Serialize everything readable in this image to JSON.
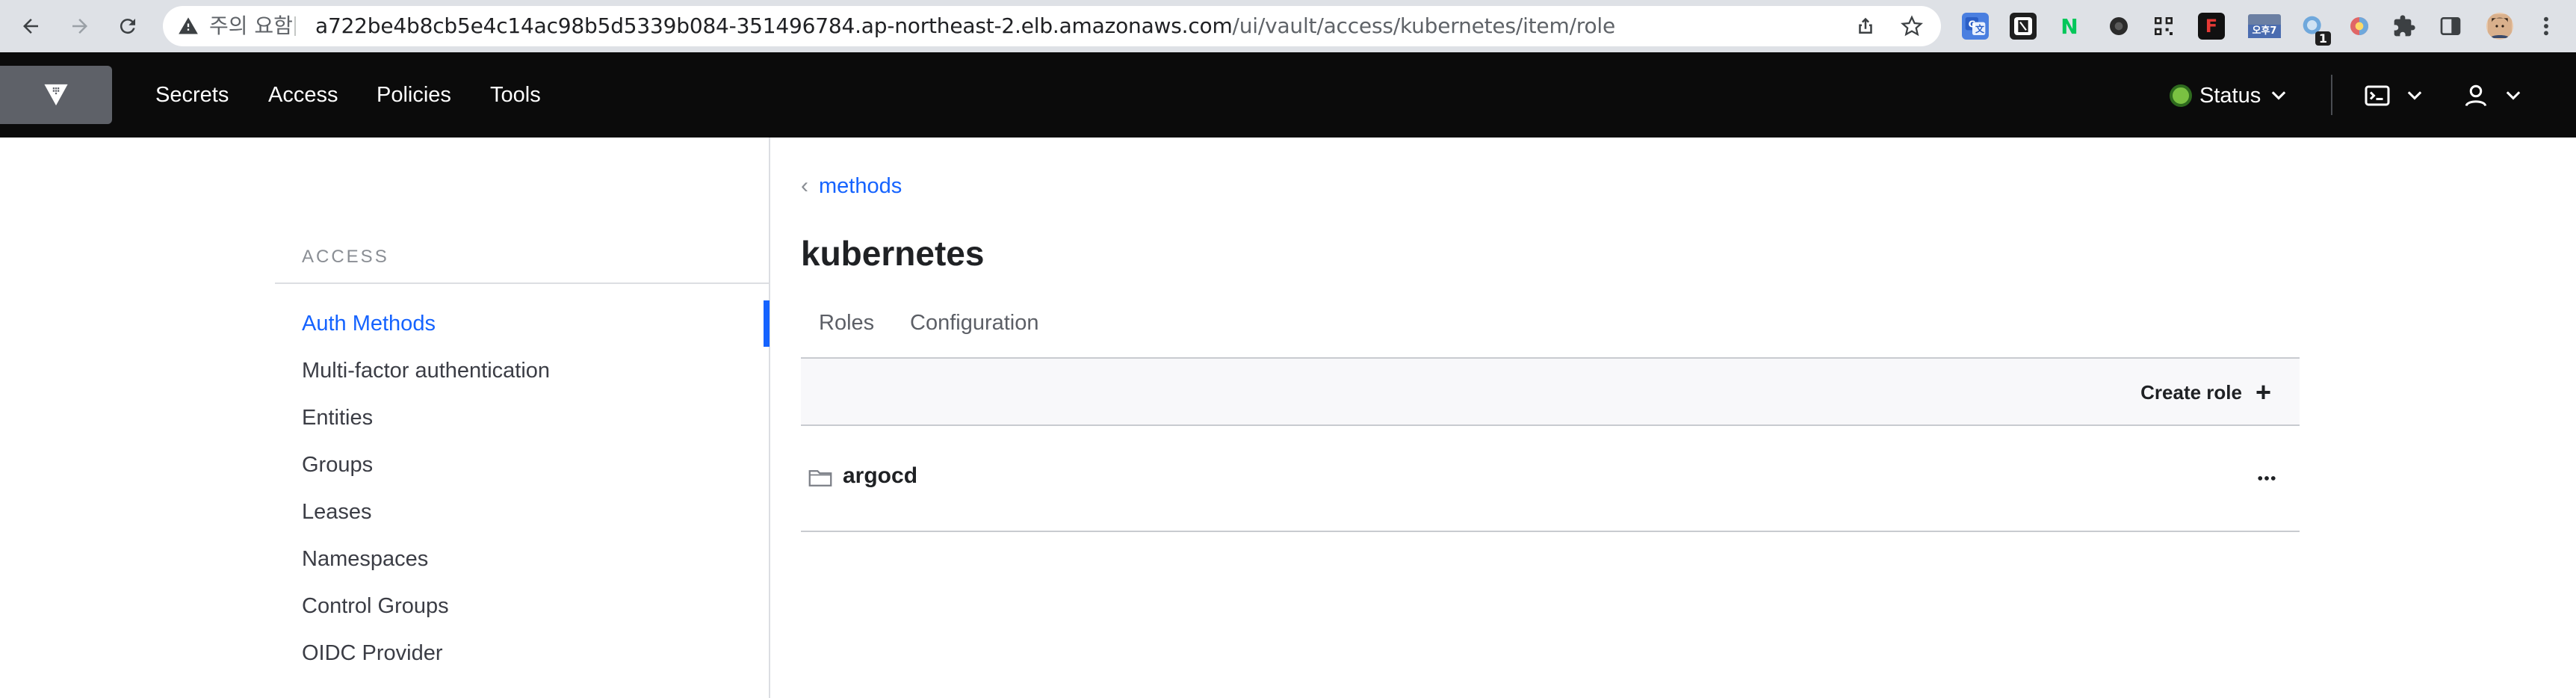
{
  "browser": {
    "security_label": "주의 요함",
    "url_host": "a722be4b8cb5e4c14ac98b5d5339b084-351496784.ap-northeast-2.elb.amazonaws.com",
    "url_path": "/ui/vault/access/kubernetes/item/role",
    "extensions": [
      "google-translate",
      "notion",
      "naver",
      "dot-ext",
      "qr-ext",
      "f-ext",
      "calendar-ext",
      "badge-ext",
      "color-ext",
      "puzzle",
      "sidebar",
      "profile",
      "kebab"
    ],
    "ext_badge_text": "1",
    "naver_label": "N",
    "f_label": "F",
    "calendar_label": "오후7"
  },
  "header": {
    "nav": [
      "Secrets",
      "Access",
      "Policies",
      "Tools"
    ],
    "status_label": "Status",
    "status_color": "#7ac142"
  },
  "sidebar": {
    "title": "ACCESS",
    "items": [
      {
        "label": "Auth Methods",
        "active": true
      },
      {
        "label": "Multi-factor authentication",
        "active": false
      },
      {
        "label": "Entities",
        "active": false
      },
      {
        "label": "Groups",
        "active": false
      },
      {
        "label": "Leases",
        "active": false
      },
      {
        "label": "Namespaces",
        "active": false
      },
      {
        "label": "Control Groups",
        "active": false
      },
      {
        "label": "OIDC Provider",
        "active": false
      }
    ]
  },
  "main": {
    "breadcrumb": "methods",
    "title": "kubernetes",
    "tabs": [
      "Roles",
      "Configuration"
    ],
    "create_label": "Create role",
    "rows": [
      {
        "name": "argocd"
      }
    ]
  },
  "colors": {
    "accent": "#1563ff",
    "header_bg": "#0b0b0b"
  }
}
